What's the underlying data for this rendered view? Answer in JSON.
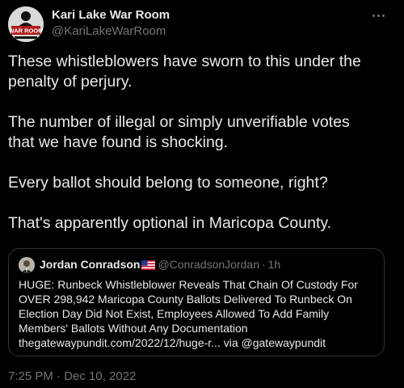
{
  "author": {
    "name": "Kari Lake War Room",
    "handle": "@KariLakeWarRoom",
    "avatar_text": "WAR ROOM"
  },
  "tweet": {
    "paragraphs": [
      {
        "lines": [
          "These whistleblowers have sworn to this under the",
          "penalty of perjury."
        ]
      },
      {
        "lines": [
          "The number of illegal or simply unverifiable votes",
          "that we have found is shocking."
        ]
      },
      {
        "lines": [
          "Every ballot should belong to someone, right?"
        ]
      },
      {
        "lines": [
          "That's apparently optional in Maricopa County."
        ]
      }
    ],
    "timestamp": "7:25 PM · Dec 10, 2022"
  },
  "quoted": {
    "name": "Jordan Conradson",
    "flag_icon": "us-flag-icon",
    "handle": "@ConradsonJordan",
    "separator": "·",
    "time": "1h",
    "lines": [
      "HUGE: Runbeck Whistleblower Reveals That Chain Of Custody For",
      "OVER 298,942 Maricopa County Ballots Delivered To Runbeck On",
      "Election Day Did Not Exist, Employees Allowed To Add Family",
      "Members' Ballots Without Any Documentation",
      "thegatewaypundit.com/2022/12/huge-r... via @gatewaypundit"
    ]
  },
  "colors": {
    "background": "#000000",
    "text_primary": "#e7e9ea",
    "text_secondary": "#71767b",
    "border": "#2f3336",
    "avatar_bg": "#d9d9d9",
    "war_room_red": "#b01b1b"
  },
  "icons": {
    "more": "more-horizontal-icon"
  }
}
